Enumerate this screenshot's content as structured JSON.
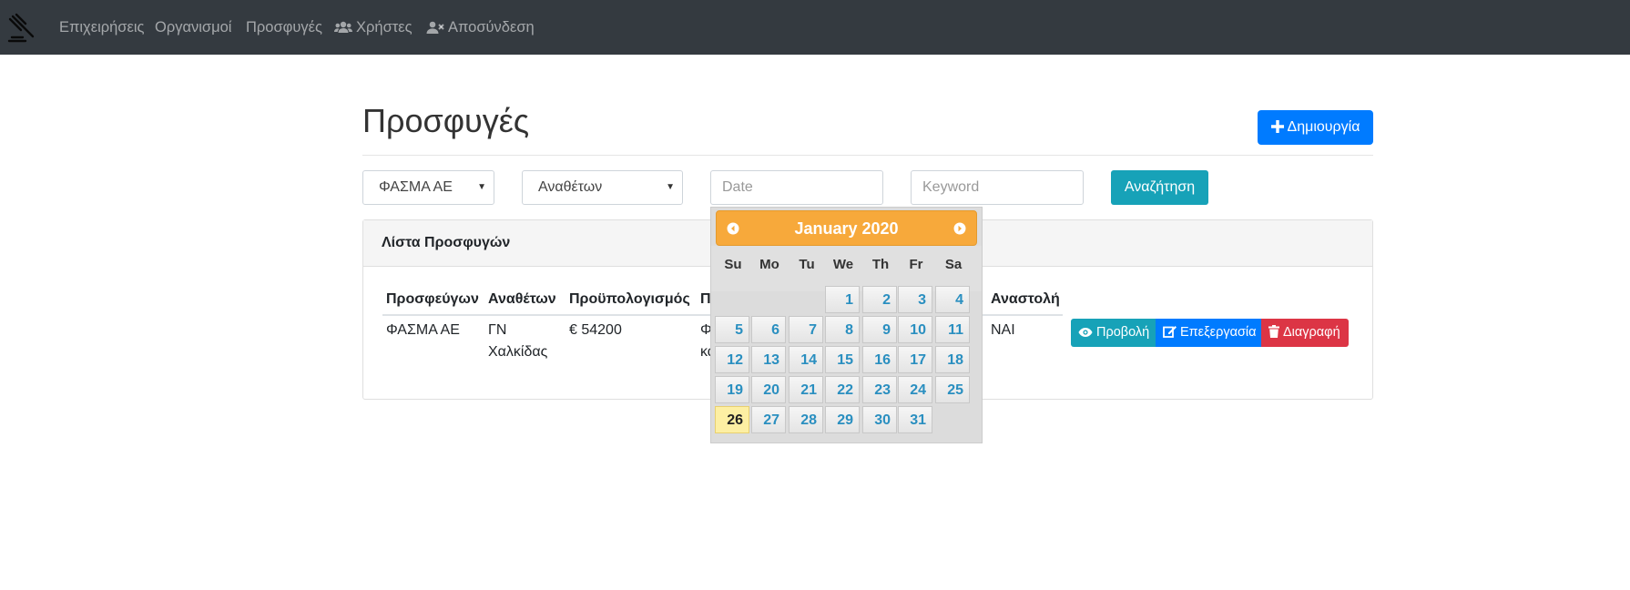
{
  "nav": {
    "items": [
      {
        "label": "Επιχειρήσεις"
      },
      {
        "label": "Οργανισμοί"
      },
      {
        "label": "Προσφυγές"
      },
      {
        "label": "Χρήστες",
        "icon": "users-icon"
      },
      {
        "label": "Αποσύνδεση",
        "icon": "user-times-icon"
      }
    ],
    "brand_icon": "gavel-icon"
  },
  "page": {
    "title": "Προσφυγές",
    "create_button": "Δημιουργία"
  },
  "filters": {
    "company_select": "ΦΑΣΜΑ ΑΕ",
    "authority_select": "Αναθέτων",
    "date_placeholder": "Date",
    "keyword_placeholder": "Keyword",
    "search_button": "Αναζήτηση"
  },
  "card": {
    "title": "Λίστα Προσφυγών",
    "columns": [
      "Προσφεύγων",
      "Αναθέτων",
      "Προϋπολογισμός",
      "Π",
      "Αναστολή"
    ],
    "rows": [
      {
        "applicant": "ΦΑΣΜΑ ΑΕ",
        "authority_line1": "ΓΝ",
        "authority_line2": "Χαλκίδας",
        "budget": "€ 54200",
        "partial_line1": "Φ",
        "partial_line2": "κα",
        "suspension": "ΝΑΙ",
        "actions": {
          "view": "Προβολή",
          "edit": "Επεξεργασία",
          "delete": "Διαγραφή"
        }
      }
    ]
  },
  "datepicker": {
    "month_label": "January 2020",
    "weekdays": [
      "Su",
      "Mo",
      "Tu",
      "We",
      "Th",
      "Fr",
      "Sa"
    ],
    "days": [
      "1",
      "2",
      "3",
      "4",
      "5",
      "6",
      "7",
      "8",
      "9",
      "10",
      "11",
      "12",
      "13",
      "14",
      "15",
      "16",
      "17",
      "18",
      "19",
      "20",
      "21",
      "22",
      "23",
      "24",
      "25",
      "26",
      "27",
      "28",
      "29",
      "30",
      "31"
    ],
    "first_weekday_index": 3,
    "today": "26"
  },
  "colors": {
    "navbar": "#343a40",
    "primary": "#007bff",
    "info": "#17a2b8",
    "danger": "#dc3545",
    "picker_header": "#f7a93b"
  }
}
